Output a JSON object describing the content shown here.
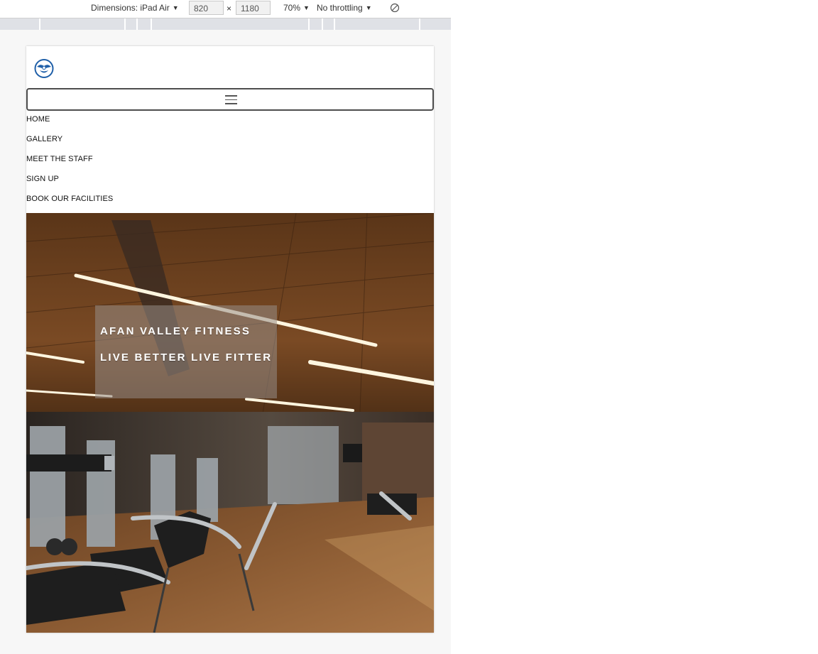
{
  "devtools": {
    "dimensions_label": "Dimensions: iPad Air",
    "width_value": "820",
    "times_sign": "×",
    "height_value": "1180",
    "zoom_label": "70%",
    "throttling_label": "No throttling",
    "rotate_icon": "rotate-icon",
    "caret": "▼"
  },
  "site": {
    "logo_icon": "club-logo-icon",
    "menu_icon": "hamburger-menu-icon",
    "nav": [
      {
        "label": "HOME"
      },
      {
        "label": "GALLERY"
      },
      {
        "label": "MEET THE STAFF"
      },
      {
        "label": "SIGN UP"
      },
      {
        "label": "BOOK OUR FACILITIES"
      }
    ],
    "hero": {
      "title": "AFAN VALLEY FITNESS",
      "tagline": "LIVE BETTER LIVE FITTER",
      "image": "gym-interior-photo"
    }
  }
}
